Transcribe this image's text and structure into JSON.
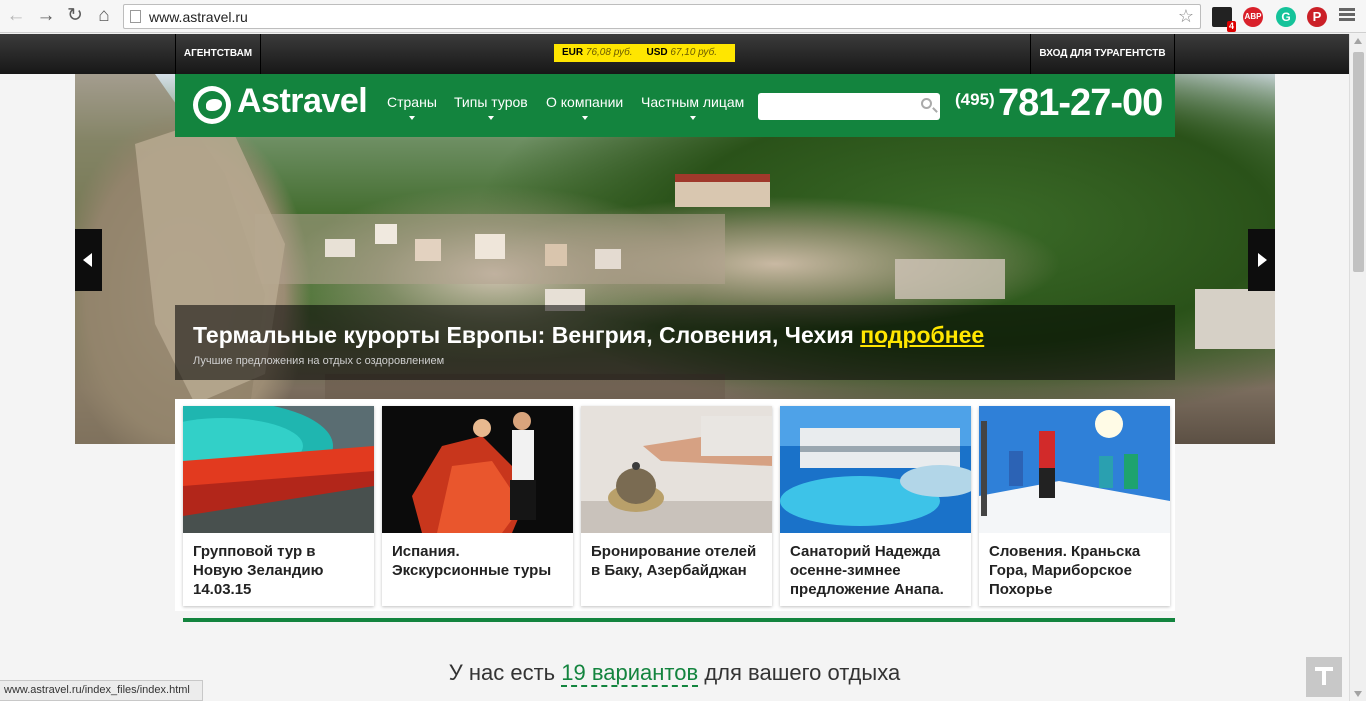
{
  "browser": {
    "url": "www.astravel.ru",
    "ext_badge_count": "4",
    "ext_abp": "ABP"
  },
  "topbar": {
    "agencies": "АГЕНТСТВАМ",
    "eur_label": "EUR",
    "eur_value": "76,08 руб.",
    "usd_label": "USD",
    "usd_value": "67,10 руб.",
    "agent_login": "ВХОД ДЛЯ ТУРАГЕНТСТВ"
  },
  "header": {
    "logo": "Astravel",
    "nav": [
      "Страны",
      "Типы туров",
      "О компании",
      "Частным лицам"
    ],
    "search_placeholder": "",
    "phone_code": "(495)",
    "phone_number": "781-27-00"
  },
  "hero": {
    "title": "Термальные курорты Европы: Венгрия, Словения, Чехия",
    "more_link": "подробнее",
    "subtitle": "Лучшие предложения на отдых с оздоровлением"
  },
  "cards": [
    {
      "text": "Групповой тур в Новую Зеландию 14.03.15"
    },
    {
      "text": "Испания. Экскурсионные туры"
    },
    {
      "text": "Бронирование отелей в Баку, Азербайджан"
    },
    {
      "text": "Санаторий Надежда осенне-зимнее предложение Анапа."
    },
    {
      "text": "Словения. Краньска Гора, Мариборское Похорье"
    }
  ],
  "variants": {
    "before": "У нас есть",
    "highlight": "19 вариантов",
    "after": "для вашего отдыха"
  },
  "status_bar": "www.astravel.ru/index_files/index.html",
  "colors": {
    "brand_green": "#13843e",
    "currency_yellow": "#ffe600",
    "link_yellow": "#ffe600"
  }
}
